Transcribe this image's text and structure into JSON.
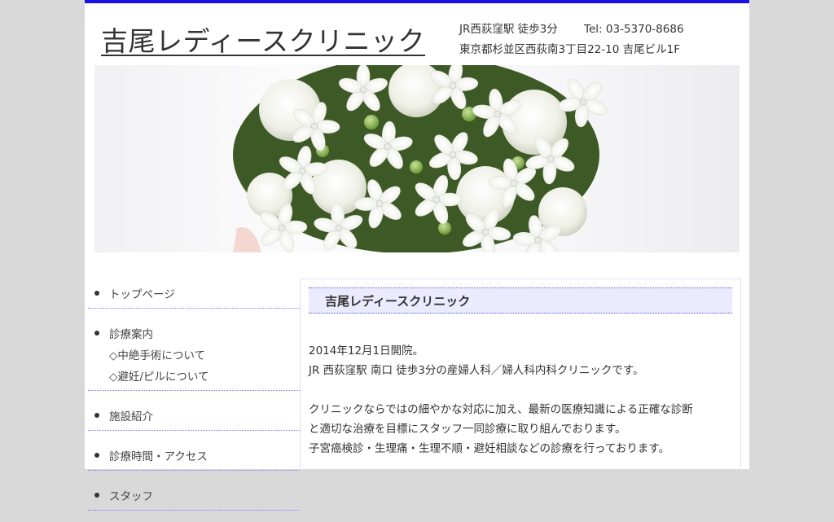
{
  "header": {
    "site_title": "吉尾レディースクリニック",
    "station": "JR西荻窪駅 徒歩3分",
    "tel": "Tel: 03-5370-8686",
    "address": "東京都杉並区西荻南3丁目22-10 吉尾ビル1F"
  },
  "colors": {
    "accent": "#1a10e0",
    "heading_bg": "#ebebff",
    "page_bg": "#d9d9d9"
  },
  "sidebar": {
    "items": [
      {
        "label": "トップページ"
      },
      {
        "label": "診療案内",
        "subs": [
          "◇中絶手術について",
          "◇避妊/ピルについて"
        ]
      },
      {
        "label": "施設紹介"
      },
      {
        "label": "診療時間・アクセス"
      },
      {
        "label": "スタッフ"
      }
    ]
  },
  "main": {
    "heading": "吉尾レディースクリニック",
    "paragraphs": [
      [
        "2014年12月1日開院。",
        "JR 西荻窪駅 南口 徒歩3分の産婦人科／婦人科内科クリニックです。"
      ],
      [
        "クリニックならではの細やかな対応に加え、最新の医療知識による正確な診断",
        "と適切な治療を目標にスタッフ一同診療に取り組んでおります。",
        "子宮癌検診・生理痛・生理不順・避妊相談などの診療を行っております。"
      ]
    ]
  }
}
